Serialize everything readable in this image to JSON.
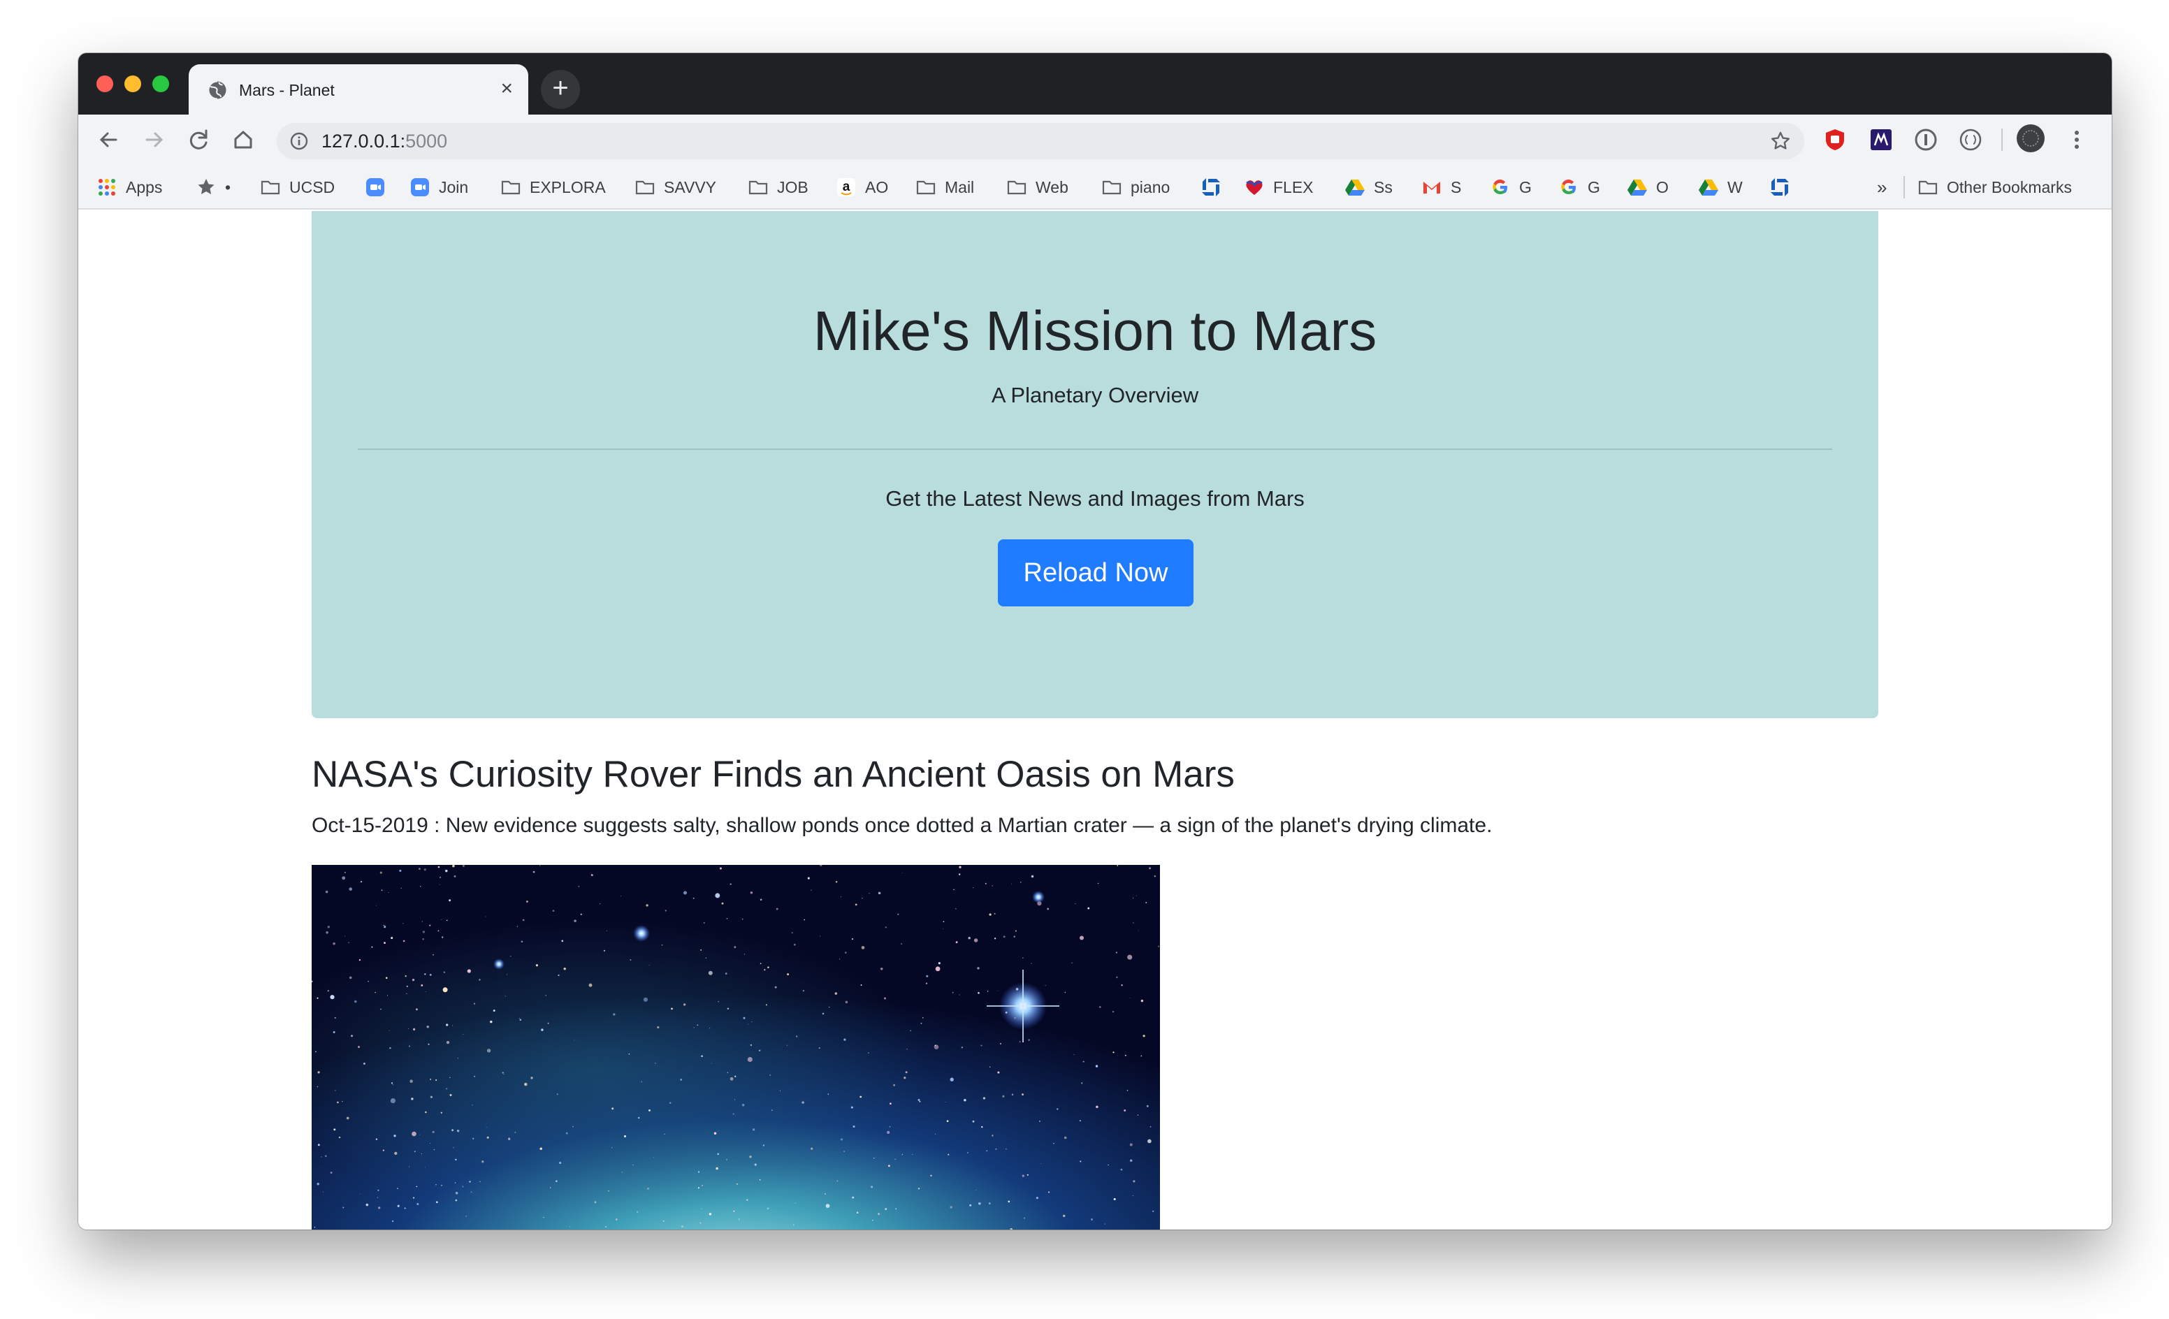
{
  "browser": {
    "tab_title": "Mars - Planet",
    "tab_close": "×",
    "new_tab": "+",
    "url_host": "127.0.0.1:",
    "url_port": "5000"
  },
  "bookmarks": [
    {
      "label": "Apps",
      "icon": "apps-grid-icon"
    },
    {
      "label": "•",
      "icon": "star-icon"
    },
    {
      "label": "UCSD",
      "icon": "folder-icon"
    },
    {
      "label": "",
      "icon": "zoom-icon"
    },
    {
      "label": "Join",
      "icon": "zoom-icon"
    },
    {
      "label": "EXPLORA",
      "icon": "folder-icon"
    },
    {
      "label": "SAVVY",
      "icon": "folder-icon"
    },
    {
      "label": "JOB",
      "icon": "folder-icon"
    },
    {
      "label": "AO",
      "icon": "amazon-icon"
    },
    {
      "label": "Mail",
      "icon": "folder-icon"
    },
    {
      "label": "Web",
      "icon": "folder-icon"
    },
    {
      "label": "piano",
      "icon": "folder-icon"
    },
    {
      "label": "",
      "icon": "chase-icon"
    },
    {
      "label": "FLEX",
      "icon": "southwest-icon"
    },
    {
      "label": "Ss",
      "icon": "drive-icon"
    },
    {
      "label": "S",
      "icon": "gmail-icon"
    },
    {
      "label": "G",
      "icon": "google-icon"
    },
    {
      "label": "G",
      "icon": "google-icon"
    },
    {
      "label": "O",
      "icon": "drive-icon"
    },
    {
      "label": "W",
      "icon": "drive-icon"
    },
    {
      "label": "",
      "icon": "chase-icon"
    }
  ],
  "bookmarks_overflow": "»",
  "other_bookmarks": "Other Bookmarks",
  "jumbotron": {
    "title": "Mike's Mission to Mars",
    "subtitle": "A Planetary Overview",
    "lead": "Get the Latest News and Images from Mars",
    "button": "Reload Now"
  },
  "news": {
    "title": "NASA's Curiosity Rover Finds an Ancient Oasis on Mars",
    "date": "Oct-15-2019",
    "separator": " : ",
    "paragraph": "New evidence suggests salty, shallow ponds once dotted a Martian crater — a sign of the planet's drying climate."
  },
  "colors": {
    "jumbotron_bg": "#b8dddc",
    "button_bg": "#1f7bff",
    "tabstrip_bg": "#202124"
  }
}
